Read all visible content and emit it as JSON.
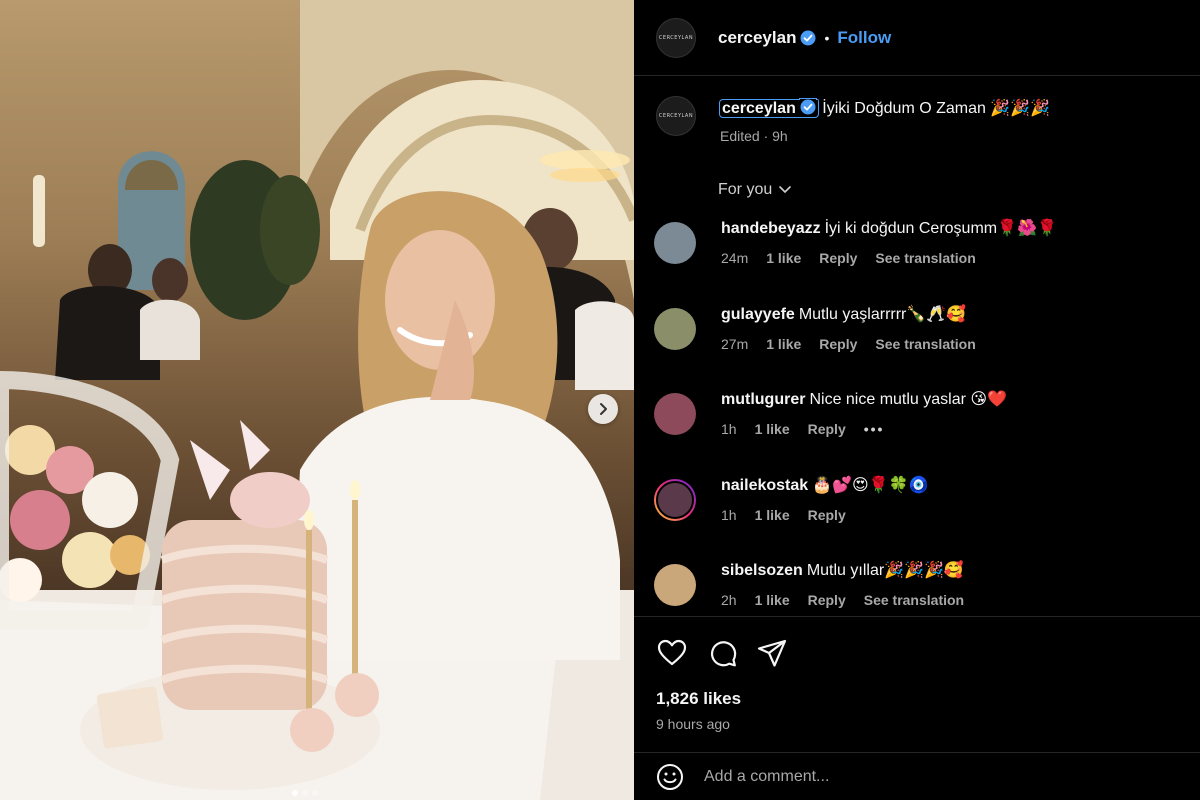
{
  "post": {
    "author": "cerceylan",
    "avatar_text": "CERCEYLAN",
    "follow_label": "Follow",
    "separator": "•",
    "caption_text": "İyiki Doğdum O Zaman 🎉🎉🎉",
    "caption_meta": "Edited · 9h",
    "filter_label": "For you",
    "likes": "1,826 likes",
    "posted_ago": "9 hours ago",
    "add_comment_placeholder": "Add a comment..."
  },
  "comments": [
    {
      "user": "handebeyazz",
      "text": "İyi ki doğdun Ceroşumm🌹🌺🌹",
      "time": "24m",
      "likes": "1 like",
      "reply": "Reply",
      "translate": "See translation",
      "avatar_color": "#7c8a96"
    },
    {
      "user": "gulayyefe",
      "text": "Mutlu yaşlarrrrr🍾🥂🥰",
      "time": "27m",
      "likes": "1 like",
      "reply": "Reply",
      "translate": "See translation",
      "avatar_color": "#8a8f6a"
    },
    {
      "user": "mutlugurer",
      "text": "Nice nice mutlu yaslar 😘❤️",
      "time": "1h",
      "likes": "1 like",
      "reply": "Reply",
      "translate": "",
      "avatar_color": "#8c4a5a"
    },
    {
      "user": "nailekostak",
      "text": "🎂💕😍🌹🍀🧿",
      "time": "1h",
      "likes": "1 like",
      "reply": "Reply",
      "translate": "",
      "avatar_color": "#5a3a4a"
    },
    {
      "user": "sibelsozen",
      "text": "Mutlu yıllar🎉🎉🎉🥰",
      "time": "2h",
      "likes": "1 like",
      "reply": "Reply",
      "translate": "See translation",
      "avatar_color": "#c9a77a"
    }
  ],
  "colors": {
    "accent": "#4a9cf5",
    "background": "#000000",
    "muted": "#a8a8a8"
  },
  "icons": [
    "verified-badge-icon",
    "chevron-down-icon",
    "heart-icon",
    "comment-icon",
    "share-icon",
    "emoji-icon",
    "next-arrow-icon",
    "more-options-icon"
  ]
}
